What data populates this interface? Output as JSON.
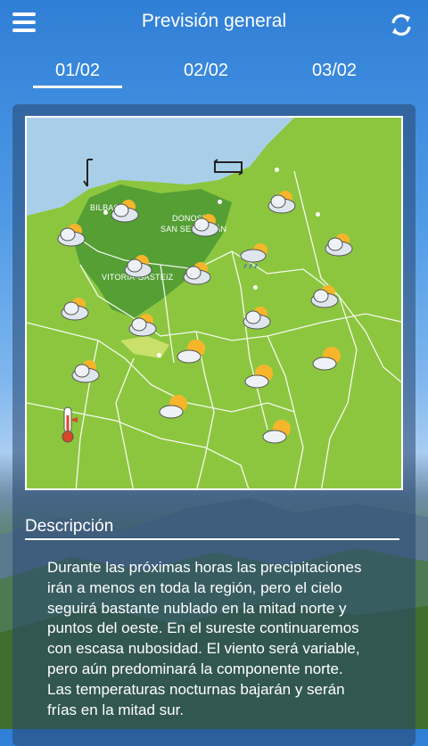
{
  "header": {
    "title": "Previsión general"
  },
  "tabs": [
    {
      "label": "01/02",
      "active": true
    },
    {
      "label": "02/02",
      "active": false
    },
    {
      "label": "03/02",
      "active": false
    }
  ],
  "map": {
    "cities": [
      "BILBAO",
      "DONOSTIA",
      "SAN SEBASTIÁN",
      "VITORIA-GASTEIZ"
    ]
  },
  "description": {
    "title": "Descripción",
    "text": "Durante las próximas horas las precipitaciones irán a menos en toda la región, pero el cielo seguirá bastante nublado en la mitad norte y puntos del oeste. En el sureste continuaremos con escasa nubosidad. El viento será variable, pero aún predominará la componente norte. Las temperaturas nocturnas bajarán y serán frías en la mitad sur."
  },
  "colors": {
    "accent": "#2f7fd6",
    "map_land": "#8cc63f",
    "map_sea": "#a9cfe8",
    "map_dark": "#4f9a34"
  }
}
